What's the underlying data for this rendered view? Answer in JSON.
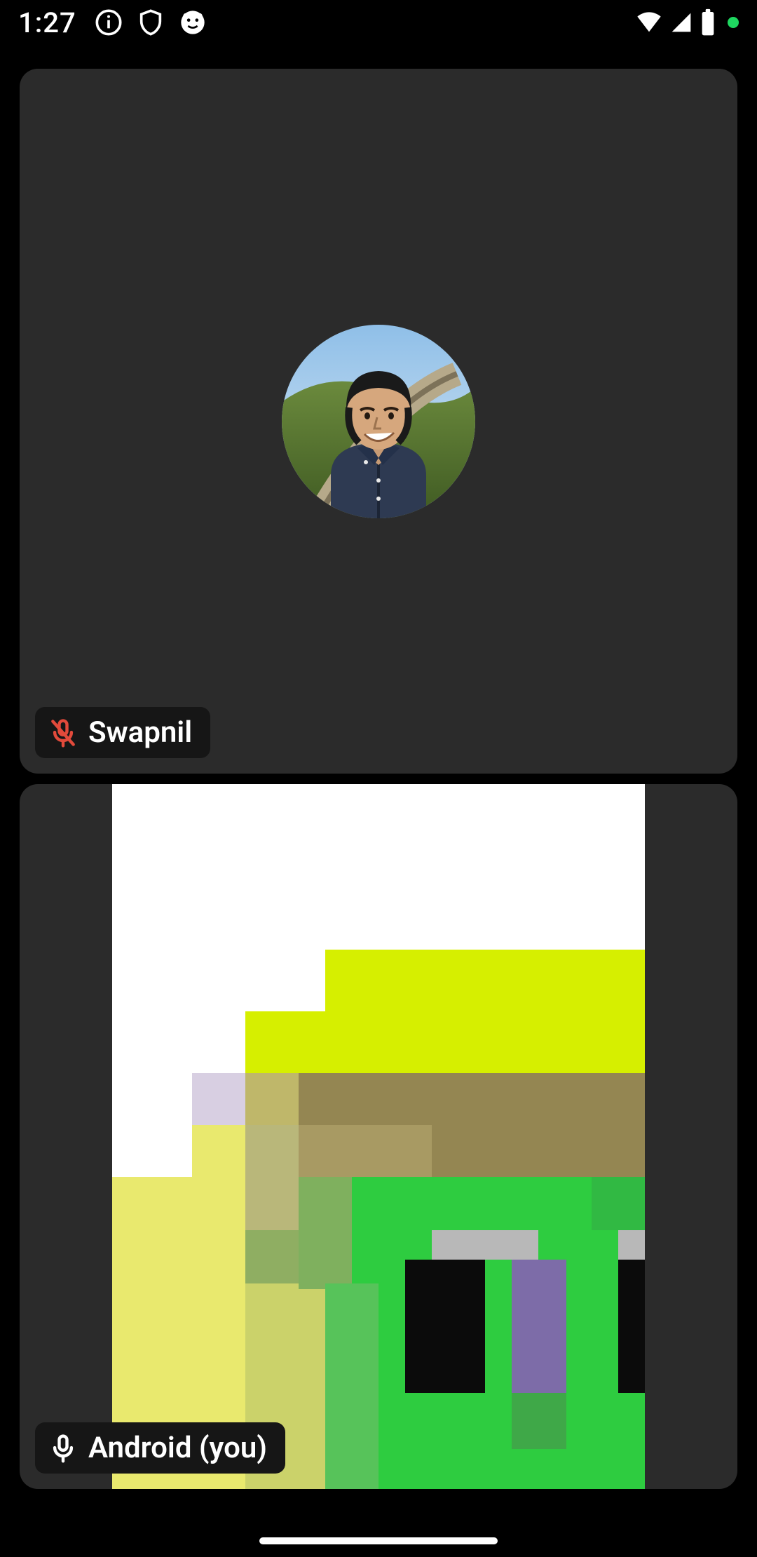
{
  "status_bar": {
    "time": "1:27",
    "icons_left": [
      "info-icon",
      "shield-icon",
      "face-icon"
    ],
    "icons_right": [
      "wifi-icon",
      "cell-signal-icon",
      "battery-icon",
      "active-dot"
    ]
  },
  "participants": [
    {
      "name": "Swapnil",
      "is_self": false,
      "muted": true,
      "camera_on": false,
      "mic_icon_color": "#e24a3b"
    },
    {
      "name": "Android (you)",
      "is_self": true,
      "muted": false,
      "camera_on": true,
      "mic_icon_color": "#ffffff"
    }
  ],
  "colors": {
    "tile_bg": "#2b2b2b",
    "badge_bg": "#161616",
    "muted_red": "#e24a3b",
    "accent_green": "#1ed760"
  }
}
